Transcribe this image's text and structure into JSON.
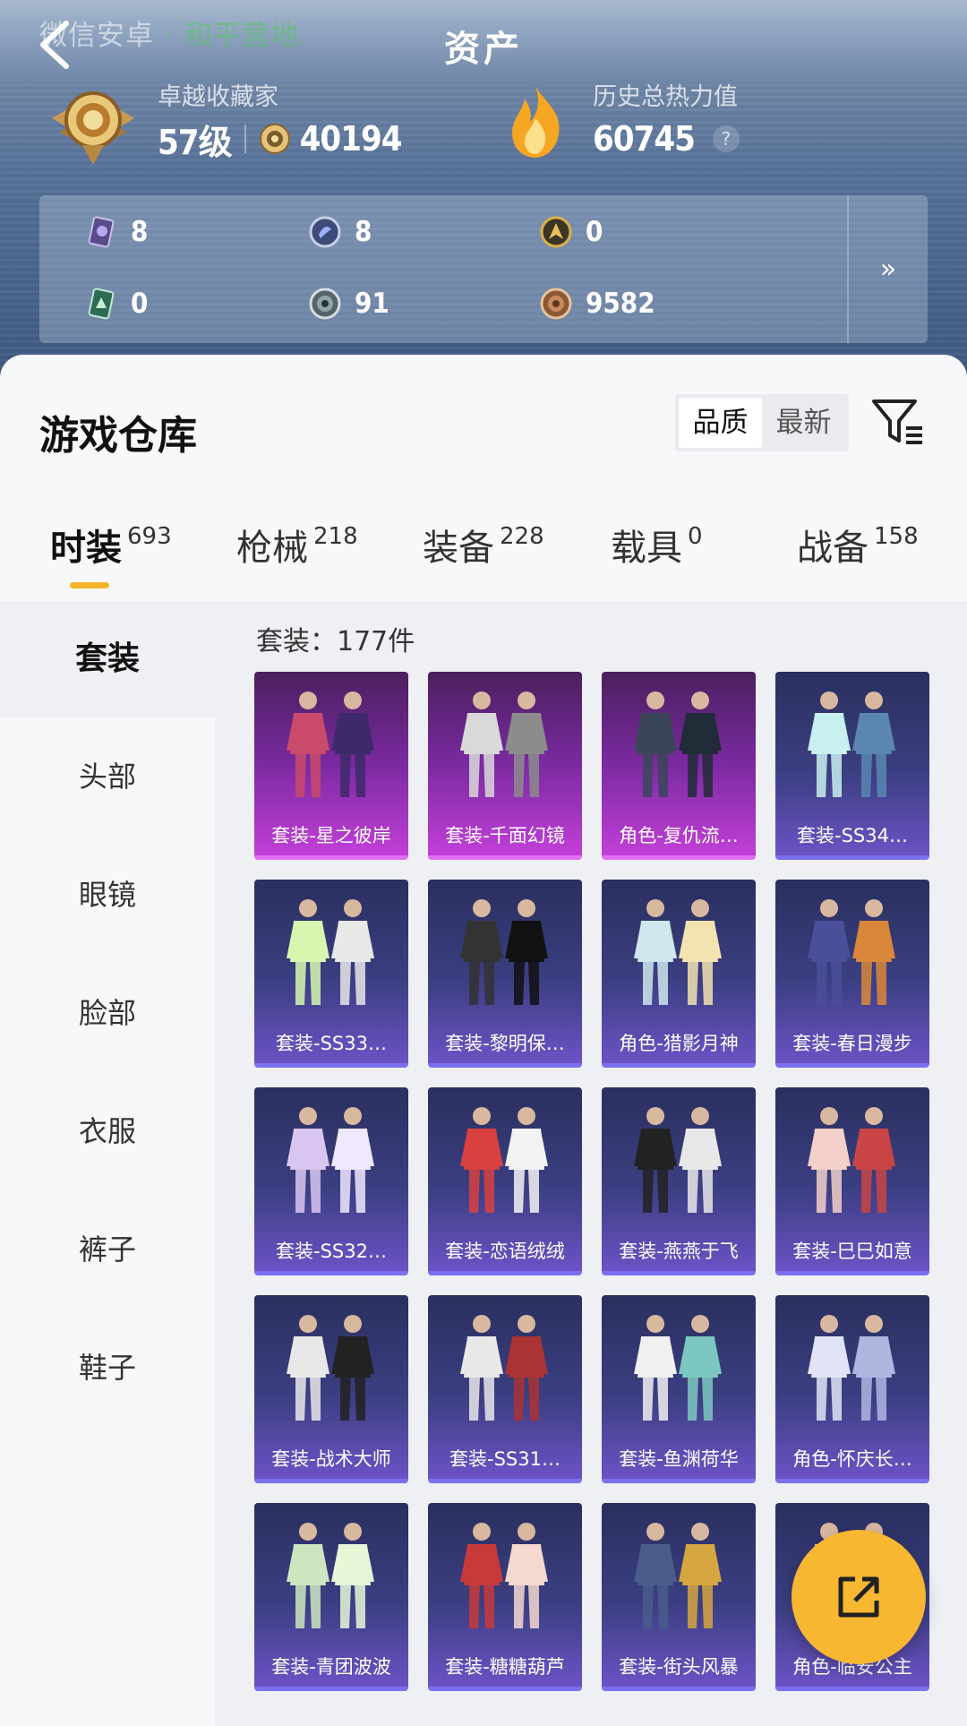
{
  "header": {
    "watermark_text": "微信安卓",
    "watermark_green": "· 和平营地",
    "title": "资产"
  },
  "profile": {
    "collector_title": "卓越收藏家",
    "level": "57级",
    "collect_points": "40194",
    "heat_title": "历史总热力值",
    "heat_value": "60745",
    "help_mark": "?"
  },
  "currencies": [
    {
      "icon": "purple-card-icon",
      "value": "8"
    },
    {
      "icon": "blue-token-icon",
      "value": "8"
    },
    {
      "icon": "gold-emblem-icon",
      "value": "0"
    },
    {
      "icon": "green-card-icon",
      "value": "0"
    },
    {
      "icon": "silver-coin-icon",
      "value": "91"
    },
    {
      "icon": "bronze-coin-icon",
      "value": "9582"
    }
  ],
  "panel_more": "»",
  "warehouse": {
    "title": "游戏仓库",
    "sort_options": [
      "品质",
      "最新"
    ],
    "active_sort": "品质"
  },
  "tabs": [
    {
      "label": "时装",
      "count": "693"
    },
    {
      "label": "枪械",
      "count": "218"
    },
    {
      "label": "装备",
      "count": "228"
    },
    {
      "label": "载具",
      "count": "0"
    },
    {
      "label": "战备",
      "count": "158"
    }
  ],
  "sidebar": [
    "套装",
    "头部",
    "眼镜",
    "脸部",
    "衣服",
    "裤子",
    "鞋子"
  ],
  "count_label": "套装：177件",
  "items": [
    {
      "label": "套装-星之彼岸",
      "rarity": "legendary"
    },
    {
      "label": "套装-千面幻镜",
      "rarity": "legendary"
    },
    {
      "label": "角色-复仇流…",
      "rarity": "legendary"
    },
    {
      "label": "套装-SS34…",
      "rarity": "epic"
    },
    {
      "label": "套装-SS33…",
      "rarity": "epic"
    },
    {
      "label": "套装-黎明保…",
      "rarity": "epic"
    },
    {
      "label": "角色-猎影月神",
      "rarity": "epic"
    },
    {
      "label": "套装-春日漫步",
      "rarity": "epic"
    },
    {
      "label": "套装-SS32…",
      "rarity": "epic"
    },
    {
      "label": "套装-恋语绒绒",
      "rarity": "epic"
    },
    {
      "label": "套装-燕燕于飞",
      "rarity": "epic"
    },
    {
      "label": "套装-巳巳如意",
      "rarity": "epic"
    },
    {
      "label": "套装-战术大师",
      "rarity": "epic"
    },
    {
      "label": "套装-SS31…",
      "rarity": "epic"
    },
    {
      "label": "套装-鱼渊荷华",
      "rarity": "epic"
    },
    {
      "label": "角色-怀庆长…",
      "rarity": "epic"
    },
    {
      "label": "套装-青团波波",
      "rarity": "epic"
    },
    {
      "label": "套装-糖糖葫芦",
      "rarity": "epic"
    },
    {
      "label": "套装-街头风暴",
      "rarity": "epic"
    },
    {
      "label": "角色-临安公主",
      "rarity": "epic"
    }
  ]
}
